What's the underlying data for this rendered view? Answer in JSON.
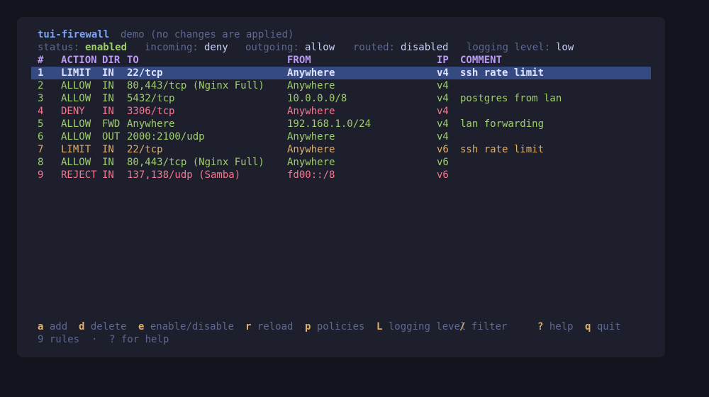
{
  "app": {
    "title": "tui-firewall",
    "subtitle": "demo (no changes are applied)"
  },
  "status": {
    "status_label": "status:",
    "status_value": "enabled",
    "incoming_label": "incoming:",
    "incoming_value": "deny",
    "outgoing_label": "outgoing:",
    "outgoing_value": "allow",
    "routed_label": "routed:",
    "routed_value": "disabled",
    "logging_label": "logging level:",
    "logging_value": "low"
  },
  "table": {
    "headers": [
      "#",
      "ACTION",
      "DIR",
      "TO",
      "FROM",
      "IP",
      "COMMENT"
    ],
    "selected_index": 0,
    "rows": [
      {
        "num": "1",
        "action": "LIMIT",
        "dir": "IN",
        "to": "22/tcp",
        "from": "Anywhere",
        "ip": "v4",
        "comment": "ssh rate limit",
        "color": "limit"
      },
      {
        "num": "2",
        "action": "ALLOW",
        "dir": "IN",
        "to": "80,443/tcp (Nginx Full)",
        "from": "Anywhere",
        "ip": "v4",
        "comment": "",
        "color": "allow"
      },
      {
        "num": "3",
        "action": "ALLOW",
        "dir": "IN",
        "to": "5432/tcp",
        "from": "10.0.0.0/8",
        "ip": "v4",
        "comment": "postgres from lan",
        "color": "allow"
      },
      {
        "num": "4",
        "action": "DENY",
        "dir": "IN",
        "to": "3306/tcp",
        "from": "Anywhere",
        "ip": "v4",
        "comment": "",
        "color": "deny"
      },
      {
        "num": "5",
        "action": "ALLOW",
        "dir": "FWD",
        "to": "Anywhere",
        "from": "192.168.1.0/24",
        "ip": "v4",
        "comment": "lan forwarding",
        "color": "allow"
      },
      {
        "num": "6",
        "action": "ALLOW",
        "dir": "OUT",
        "to": "2000:2100/udp",
        "from": "Anywhere",
        "ip": "v4",
        "comment": "",
        "color": "allow"
      },
      {
        "num": "7",
        "action": "LIMIT",
        "dir": "IN",
        "to": "22/tcp",
        "from": "Anywhere",
        "ip": "v6",
        "comment": "ssh rate limit",
        "color": "limit"
      },
      {
        "num": "8",
        "action": "ALLOW",
        "dir": "IN",
        "to": "80,443/tcp (Nginx Full)",
        "from": "Anywhere",
        "ip": "v6",
        "comment": "",
        "color": "allow"
      },
      {
        "num": "9",
        "action": "REJECT",
        "dir": "IN",
        "to": "137,138/udp (Samba)",
        "from": "fd00::/8",
        "ip": "v6",
        "comment": "",
        "color": "reject"
      }
    ]
  },
  "keys": [
    {
      "key": "a",
      "label": "add"
    },
    {
      "key": "d",
      "label": "delete"
    },
    {
      "key": "e",
      "label": "enable/disable"
    },
    {
      "key": "r",
      "label": "reload"
    },
    {
      "key": "p",
      "label": "policies"
    },
    {
      "key": "L",
      "label": "logging level"
    },
    {
      "key": "/",
      "label": "filter"
    },
    {
      "key": "?",
      "label": "help"
    },
    {
      "key": "q",
      "label": "quit"
    }
  ],
  "footer": {
    "rule_count": "9 rules",
    "separator": "·",
    "help_hint": "? for help"
  },
  "colors": {
    "background": "#12131c",
    "panel": "#1d1f2c",
    "selection": "#364a82",
    "accent_blue": "#7aa2f7",
    "accent_purple": "#bb9af7",
    "limit": "#e0af68",
    "allow": "#9ece6a",
    "deny": "#f7768e"
  }
}
